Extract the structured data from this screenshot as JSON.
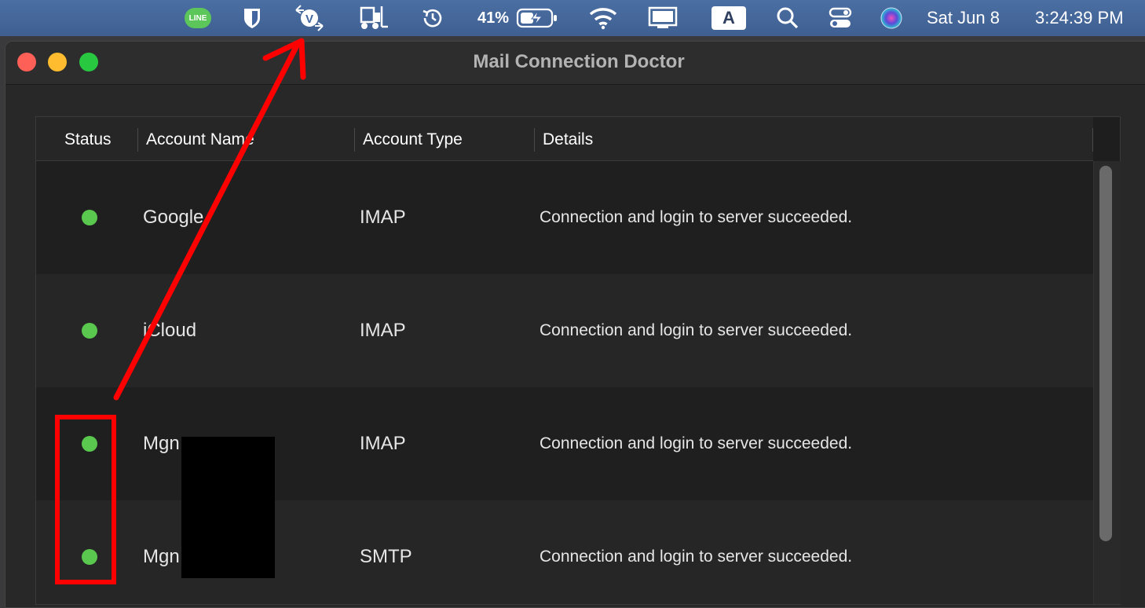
{
  "menubar": {
    "line_label": "LINE",
    "battery_percent": "41%",
    "keyboard_input": "A",
    "date": "Sat Jun 8",
    "time": "3:24:39 PM",
    "icons": [
      "line-icon",
      "bitwarden-shield-icon",
      "vpn-switch-icon",
      "forklift-icon",
      "time-machine-icon",
      "battery-charging-icon",
      "wifi-icon",
      "display-icon",
      "input-source-icon",
      "search-icon",
      "control-center-icon",
      "siri-icon"
    ]
  },
  "window": {
    "title": "Mail Connection Doctor"
  },
  "table": {
    "columns": [
      "Status",
      "Account Name",
      "Account Type",
      "Details"
    ],
    "rows": [
      {
        "status": "ok",
        "account_name": "Google",
        "account_type": "IMAP",
        "details": "Connection and login to server succeeded."
      },
      {
        "status": "ok",
        "account_name": "iCloud",
        "account_type": "IMAP",
        "details": "Connection and login to server succeeded."
      },
      {
        "status": "ok",
        "account_name": "Mgn",
        "account_type": "IMAP",
        "details": "Connection and login to server succeeded."
      },
      {
        "status": "ok",
        "account_name": "Mgn",
        "account_type": "SMTP",
        "details": "Connection and login to server succeeded."
      }
    ]
  },
  "colors": {
    "status_ok": "#5ac84e",
    "annotation": "#ff0000",
    "menubar": "#4466a0"
  }
}
